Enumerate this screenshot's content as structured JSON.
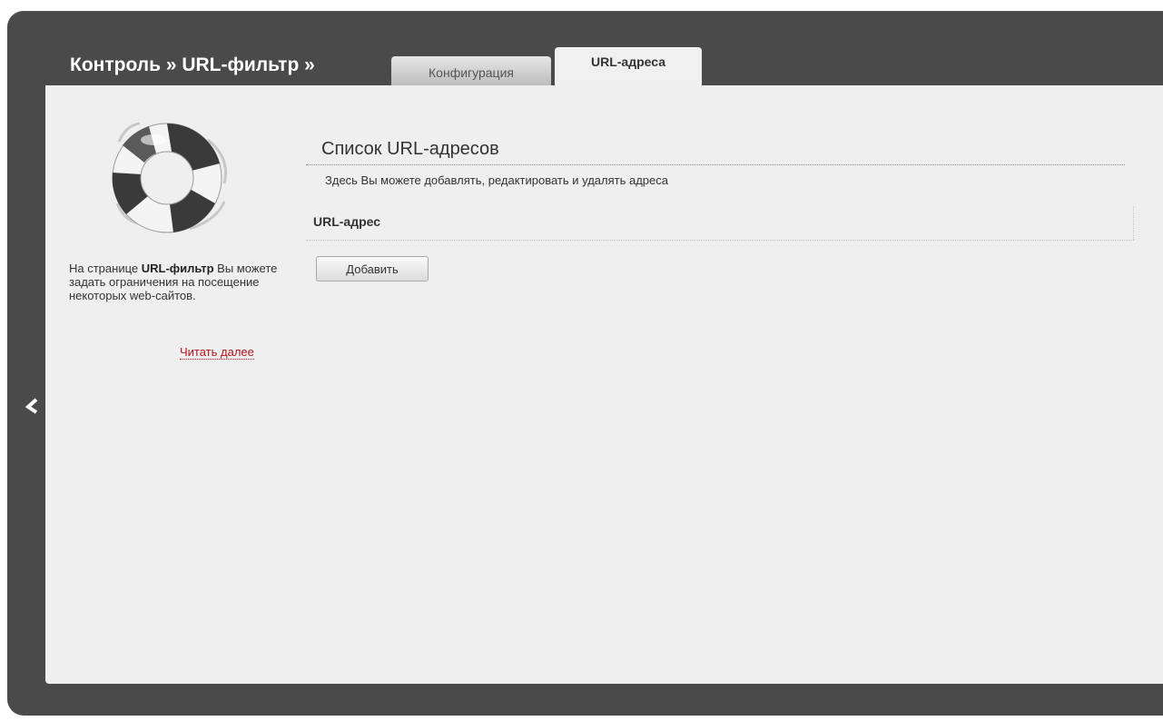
{
  "header": {
    "breadcrumb": "Контроль » URL-фильтр »"
  },
  "tabs": [
    {
      "label": "Конфигурация",
      "active": false
    },
    {
      "label": "URL-адреса",
      "active": true
    }
  ],
  "sidebar": {
    "icon": "lifebuoy-icon",
    "text_prefix": "На странице ",
    "text_bold": "URL-фильтр",
    "text_suffix": " Вы можете задать ограничения на посещение некоторых web-сайтов.",
    "read_more": "Читать далее"
  },
  "main": {
    "title": "Список URL-адресов",
    "description": "Здесь Вы можете добавлять, редактировать и удалять адреса",
    "column_header": "URL-адрес",
    "add_button": "Добавить"
  },
  "nav": {
    "back_icon": "chevron-left-icon"
  },
  "colors": {
    "frame": "#4a4a4a",
    "panel": "#efefef",
    "link": "#b4151c"
  }
}
